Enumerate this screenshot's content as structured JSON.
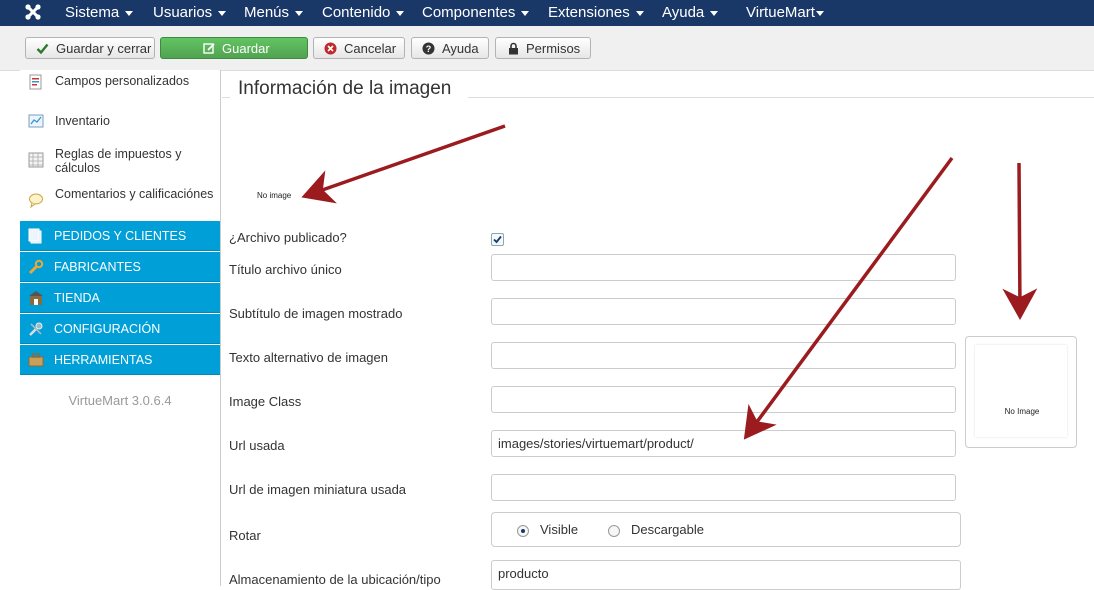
{
  "topnav": {
    "menus": [
      {
        "label": "Sistema"
      },
      {
        "label": "Usuarios"
      },
      {
        "label": "Menús"
      },
      {
        "label": "Contenido"
      },
      {
        "label": "Componentes"
      },
      {
        "label": "Extensiones"
      },
      {
        "label": "Ayuda"
      },
      {
        "label": "VirtueMart"
      }
    ]
  },
  "toolbar": {
    "save_close": "Guardar y cerrar",
    "save": "Guardar",
    "cancel": "Cancelar",
    "help": "Ayuda",
    "permissions": "Permisos"
  },
  "sidebar": {
    "items": [
      {
        "label": "Campos personalizados",
        "icon": "custom-fields-icon"
      },
      {
        "label": "Inventario",
        "icon": "inventory-icon"
      },
      {
        "label": "Reglas de impuestos y cálculos",
        "icon": "tax-rules-icon"
      },
      {
        "label": "Comentarios y calificaciónes",
        "icon": "comments-icon"
      }
    ],
    "sections": [
      {
        "label": "PEDIDOS Y CLIENTES",
        "icon": "orders-icon"
      },
      {
        "label": "FABRICANTES",
        "icon": "wrench-icon"
      },
      {
        "label": "TIENDA",
        "icon": "store-icon"
      },
      {
        "label": "CONFIGURACIÓN",
        "icon": "config-icon"
      },
      {
        "label": "HERRAMIENTAS",
        "icon": "tools-icon"
      }
    ],
    "version": "VirtueMart 3.0.6.4"
  },
  "main": {
    "title": "Información de la imagen",
    "no_image": "No image",
    "published_label": "¿Archivo publicado?",
    "published_checked": true,
    "title_label": "Título archivo único",
    "title_value": "",
    "subtitle_label": "Subtítulo de imagen mostrado",
    "subtitle_value": "",
    "alt_label": "Texto alternativo de imagen",
    "alt_value": "",
    "class_label": "Image Class",
    "class_value": "",
    "url_label": "Url usada",
    "url_value": "images/stories/virtuemart/product/",
    "thumb_url_label": "Url de imagen miniatura usada",
    "thumb_url_value": "",
    "rotate_label": "Rotar",
    "radio_visible": "Visible",
    "radio_download": "Descargable",
    "storage_label": "Almacenamiento de la ubicación/tipo",
    "storage_value": "producto",
    "thumb_no_image": "No Image"
  },
  "colors": {
    "nav_bg": "#1a3867",
    "sidebar_section": "#009fd7",
    "save_green": "#51a351",
    "arrow_red": "#9b1b1e"
  }
}
